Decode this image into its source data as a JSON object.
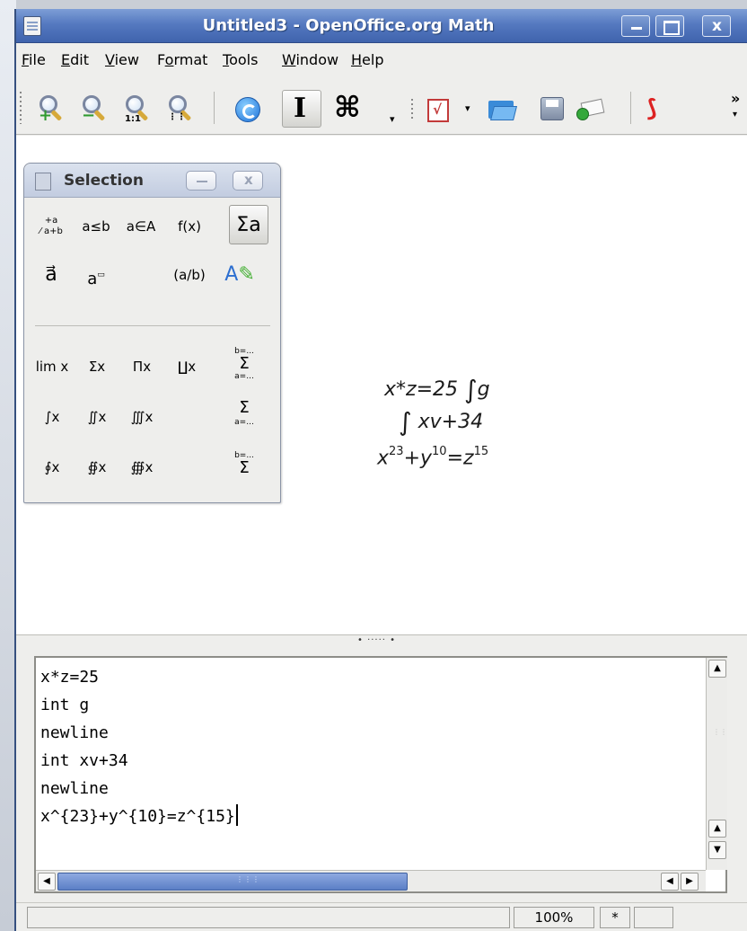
{
  "window": {
    "title": "Untitled3 - OpenOffice.org Math"
  },
  "menu": [
    {
      "label": "File",
      "key": "F"
    },
    {
      "label": "Edit",
      "key": "E"
    },
    {
      "label": "View",
      "key": "V"
    },
    {
      "label": "Format",
      "key": "o"
    },
    {
      "label": "Tools",
      "key": "T"
    },
    {
      "label": "Window",
      "key": "W"
    },
    {
      "label": "Help",
      "key": "H"
    }
  ],
  "toolbar": {
    "more": "»",
    "icons": [
      "zoom-in-icon",
      "zoom-out-icon",
      "zoom-100-icon",
      "show-all-icon",
      "update-icon",
      "formula-cursor-icon",
      "symbols-icon",
      "edit-formula-icon",
      "open-icon",
      "save-icon",
      "mail-icon",
      "export-pdf-icon"
    ]
  },
  "selection_panel": {
    "title": "Selection",
    "categories": [
      "+a/a+b",
      "a≤b",
      "a∈A",
      "f(x)",
      "Σa",
      "a⃗",
      "a",
      "(a/b)",
      ""
    ],
    "operators": {
      "row1": [
        "lim x",
        "Σx",
        "Πx",
        "∐x",
        "Σ"
      ],
      "row2": [
        "∫x",
        "∬x",
        "∭x",
        "Σ"
      ],
      "row3": [
        "∮x",
        "∯x",
        "∰x",
        "Σ"
      ],
      "limits_lower": "a=...",
      "limits_upper": "b=..."
    }
  },
  "formula_view": {
    "line1": "x*z=25",
    "line1_tail": "g",
    "line2": "xv+34",
    "line3_x": "x",
    "line3_exp1": "23",
    "line3_y": "+y",
    "line3_exp2": "10",
    "line3_z": "=z",
    "line3_exp3": "15"
  },
  "editor": {
    "lines": [
      "x*z=25",
      "int g",
      "newline",
      "int xv+34",
      "newline",
      "x^{23}+y^{10}=z^{15}"
    ]
  },
  "splitter": "• ····· •",
  "status_bar": {
    "zoom": "100%",
    "modified": "*"
  }
}
